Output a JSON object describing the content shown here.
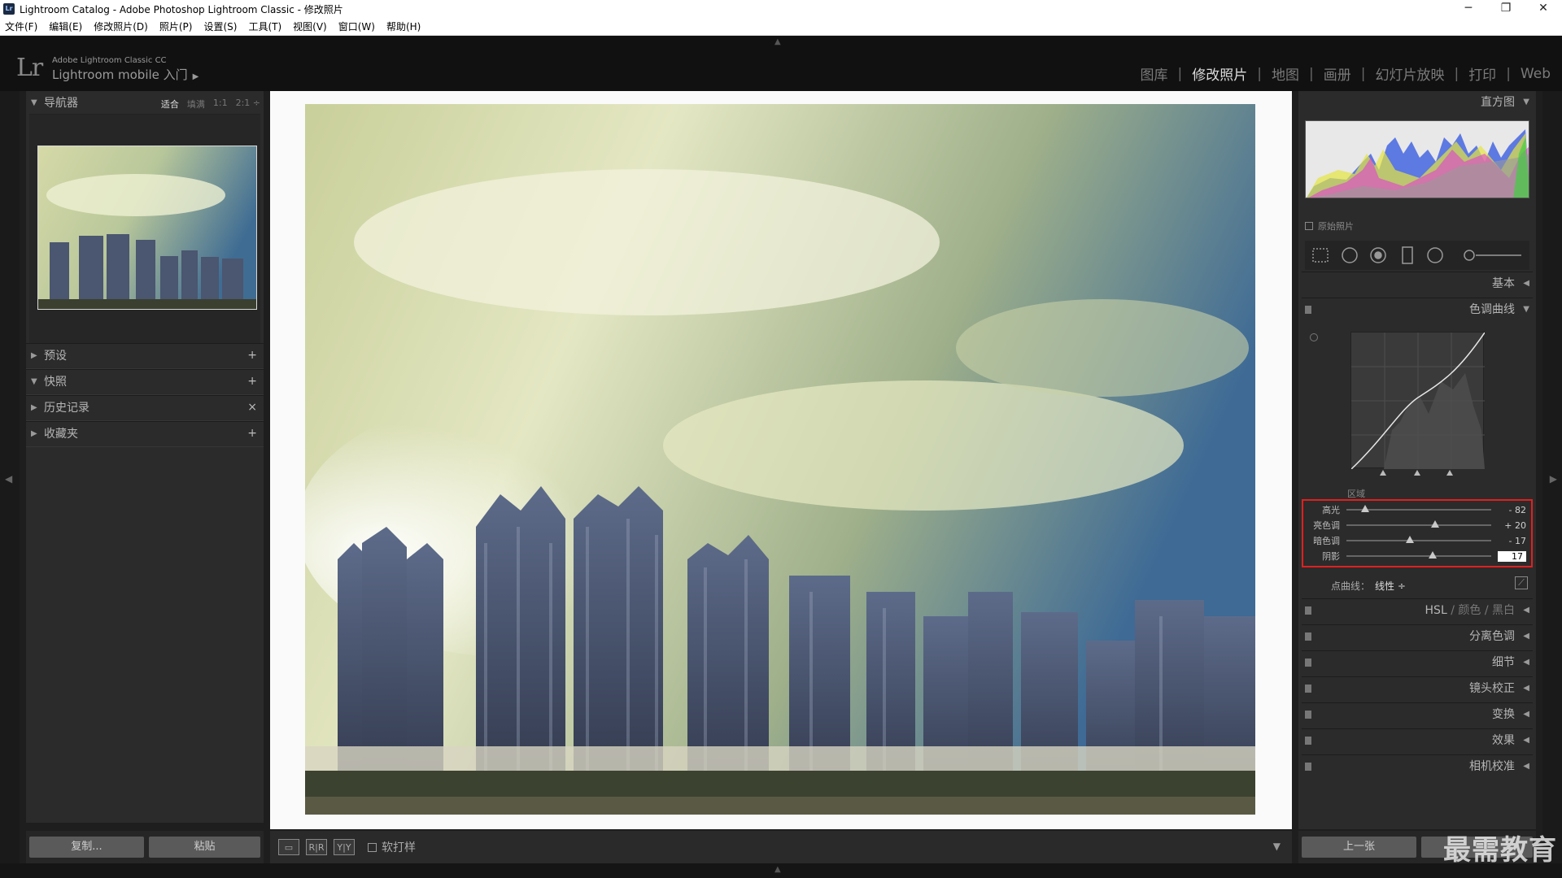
{
  "window": {
    "title": "Lightroom Catalog - Adobe Photoshop Lightroom Classic - 修改照片",
    "minimize": "─",
    "restore": "❐",
    "close": "✕"
  },
  "menu": [
    "文件(F)",
    "编辑(E)",
    "修改照片(D)",
    "照片(P)",
    "设置(S)",
    "工具(T)",
    "视图(V)",
    "窗口(W)",
    "帮助(H)"
  ],
  "identity": {
    "logo": "Lr",
    "product": "Adobe Lightroom Classic CC",
    "mobile": "Lightroom mobile 入门",
    "arrow": "▶"
  },
  "modules": [
    {
      "label": "图库",
      "active": false
    },
    {
      "label": "修改照片",
      "active": true
    },
    {
      "label": "地图",
      "active": false
    },
    {
      "label": "画册",
      "active": false
    },
    {
      "label": "幻灯片放映",
      "active": false
    },
    {
      "label": "打印",
      "active": false
    },
    {
      "label": "Web",
      "active": false
    }
  ],
  "left": {
    "navigator": {
      "title": "导航器",
      "options": [
        "适合",
        "填满",
        "1:1",
        "2:1 ÷"
      ]
    },
    "sections": [
      {
        "title": "预设",
        "action": "+",
        "expanded": false
      },
      {
        "title": "快照",
        "action": "+",
        "expanded": true
      },
      {
        "title": "历史记录",
        "action": "×",
        "expanded": false
      },
      {
        "title": "收藏夹",
        "action": "+",
        "expanded": false
      }
    ],
    "copy_button": "复制...",
    "paste_button": "粘贴"
  },
  "toolbar": {
    "view1": "▭",
    "view2": "R|R",
    "view3": "Y|Y",
    "softproof": "软打样",
    "menu": "▼"
  },
  "right": {
    "histogram_title": "直方图",
    "original_photo": "原始照片",
    "basic": "基本",
    "tone_curve": "色调曲线",
    "region": "区域",
    "sliders": [
      {
        "label": "高光",
        "value": "- 82",
        "level": -82
      },
      {
        "label": "亮色调",
        "value": "+ 20",
        "level": 20
      },
      {
        "label": "暗色调",
        "value": "- 17",
        "level": -17
      },
      {
        "label": "阴影",
        "value": "17",
        "level": 17
      }
    ],
    "point_curve_label": "点曲线：",
    "point_curve_value": "线性 ÷",
    "sections": [
      {
        "title": "HSL",
        "extra1": "颜色",
        "extra2": "黑白"
      },
      {
        "title": "分离色调"
      },
      {
        "title": "细节"
      },
      {
        "title": "镜头校正"
      },
      {
        "title": "变换"
      },
      {
        "title": "效果"
      },
      {
        "title": "相机校准"
      }
    ],
    "prev_button": "上一张"
  },
  "watermark": "最需教育",
  "colors": {
    "accent_red": "#e02020",
    "panel": "#2b2b2b",
    "canvas": "#fafafa"
  }
}
